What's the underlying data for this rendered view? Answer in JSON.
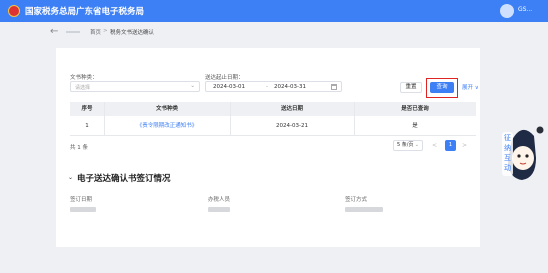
{
  "header": {
    "site_title": "国家税务总局广东省电子税务局",
    "user_label": "GS..."
  },
  "breadcrumb": {
    "home": "首页",
    "separator": ">",
    "current": "税务文书送达确认"
  },
  "filters": {
    "doc_type_label": "文书种类：",
    "doc_type_placeholder": "请选择",
    "date_label": "送达起止日期：",
    "date_start": "2024-03-01",
    "date_separator": "-",
    "date_end": "2024-03-31",
    "reset_label": "重置",
    "query_label": "查询",
    "expand_label": "展开 ∨"
  },
  "table": {
    "headers": [
      "序号",
      "文书种类",
      "送达日期",
      "是否已查询"
    ],
    "rows": [
      {
        "index": "1",
        "doc_type": "《责令限期改正通知书》",
        "date": "2024-03-21",
        "queried": "是"
      }
    ]
  },
  "pagination": {
    "total": "共 1 条",
    "page_size": "5 条/页",
    "prev": "<",
    "current_page": "1",
    "next": ">"
  },
  "signing": {
    "title": "电子送达确认书签订情况",
    "chevron": "⌄",
    "date_label": "签订日期",
    "signer_label": "办税人员",
    "method_label": "签订方式"
  },
  "assistant": {
    "text_top": "征",
    "text_left": "纳",
    "text_mid": "互",
    "text_bottom": "动"
  },
  "colors": {
    "primary": "#3d7ff5",
    "highlight": "#e02424"
  }
}
